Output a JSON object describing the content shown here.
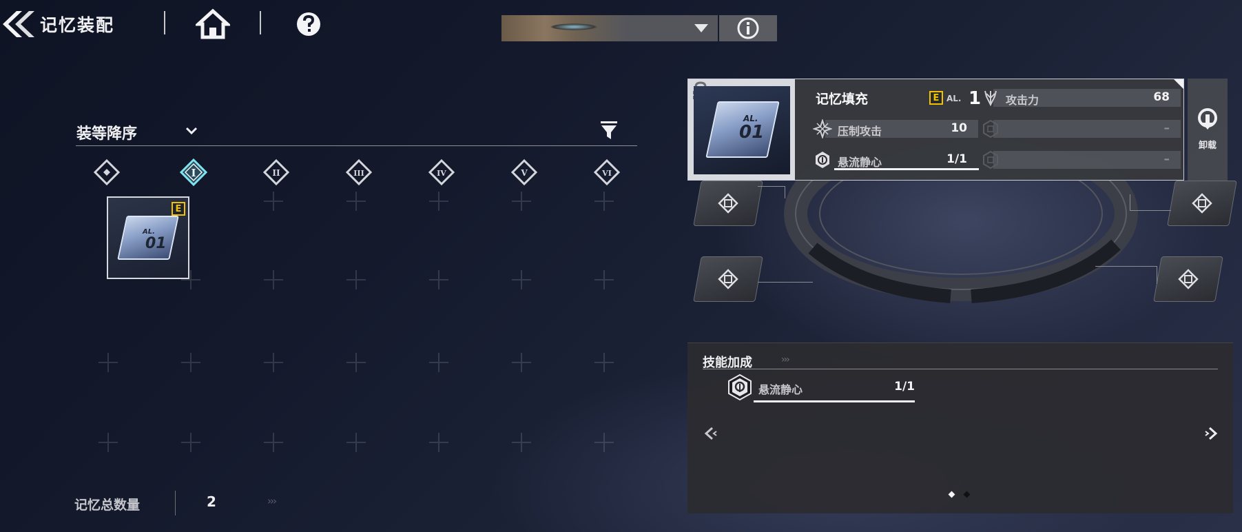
{
  "header": {
    "title": "记忆装配",
    "back_icon": "double-chevron-left-icon",
    "home_icon": "home-icon",
    "help_icon": "question-icon",
    "info_icon": "info-icon"
  },
  "sort": {
    "label": "装等降序"
  },
  "tier_tabs": [
    {
      "label": "◇",
      "name": "all",
      "selected": false
    },
    {
      "label": "I",
      "name": "tier-1",
      "selected": true
    },
    {
      "label": "II",
      "name": "tier-2",
      "selected": false
    },
    {
      "label": "III",
      "name": "tier-3",
      "selected": false
    },
    {
      "label": "IV",
      "name": "tier-4",
      "selected": false
    },
    {
      "label": "V",
      "name": "tier-5",
      "selected": false
    },
    {
      "label": "VI",
      "name": "tier-6",
      "selected": false
    }
  ],
  "inventory": [
    {
      "card_label": "AL.",
      "card_number": "01",
      "rank": "E"
    }
  ],
  "detail": {
    "card_label": "AL.",
    "card_number": "01",
    "name": "记忆填充",
    "rank": "E",
    "al_label": "AL.",
    "al_value": "1",
    "stats": [
      {
        "icon": "attack-icon",
        "label": "攻击力",
        "value": "68",
        "dim": false
      },
      {
        "icon": "suppress-attack-icon",
        "label": "压制攻击",
        "value": "10",
        "dim": false
      },
      {
        "icon": "empty-stat-icon",
        "label": "",
        "value": "–",
        "dim": true
      },
      {
        "icon": "skill-icon",
        "label": "悬流静心",
        "value": "1/1",
        "dim": false
      },
      {
        "icon": "empty-stat-icon",
        "label": "",
        "value": "–",
        "dim": true
      }
    ],
    "unload_label": "卸载"
  },
  "skill_bonus": {
    "title": "技能加成",
    "arrows": "›››",
    "entries": [
      {
        "label": "悬流静心",
        "value": "1/1"
      }
    ],
    "page_count": 2,
    "current_page": 0
  },
  "totals": {
    "label": "记忆总数量",
    "value": "2",
    "more": "›››"
  },
  "colors": {
    "accent_cyan": "#7fe4ee",
    "rank_yellow": "#f2c200",
    "panel_light": "#eceef2",
    "panel_dark": "#2c2c30"
  }
}
